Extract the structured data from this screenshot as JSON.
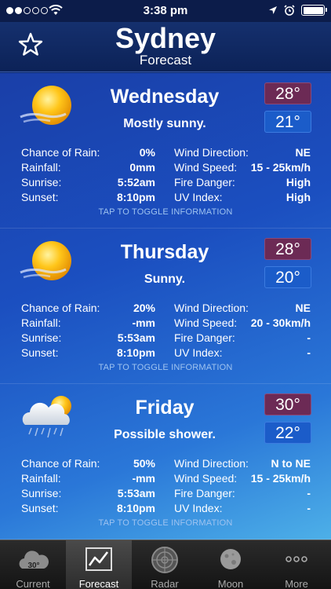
{
  "status": {
    "time": "3:38 pm",
    "signal_bars": 2,
    "battery_level": 1.0
  },
  "header": {
    "city": "Sydney",
    "subtitle": "Forecast"
  },
  "labels": {
    "chance_of_rain": "Chance of Rain:",
    "rainfall": "Rainfall:",
    "sunrise": "Sunrise:",
    "sunset": "Sunset:",
    "wind_direction": "Wind Direction:",
    "wind_speed": "Wind Speed:",
    "fire_danger": "Fire Danger:",
    "uv_index": "UV Index:",
    "toggle": "TAP TO TOGGLE INFORMATION"
  },
  "days": [
    {
      "name": "Wednesday",
      "summary": "Mostly sunny.",
      "icon": "sun-icon",
      "high": "28°",
      "low": "21°",
      "chance_of_rain": "0%",
      "rainfall": "0mm",
      "sunrise": "5:52am",
      "sunset": "8:10pm",
      "wind_direction": "NE",
      "wind_speed": "15 - 25km/h",
      "fire_danger": "High",
      "uv_index": "High"
    },
    {
      "name": "Thursday",
      "summary": "Sunny.",
      "icon": "sun-icon",
      "high": "28°",
      "low": "20°",
      "chance_of_rain": "20%",
      "rainfall": "-mm",
      "sunrise": "5:53am",
      "sunset": "8:10pm",
      "wind_direction": "NE",
      "wind_speed": "20 - 30km/h",
      "fire_danger": "-",
      "uv_index": "-"
    },
    {
      "name": "Friday",
      "summary": "Possible shower.",
      "icon": "shower-icon",
      "high": "30°",
      "low": "22°",
      "chance_of_rain": "50%",
      "rainfall": "-mm",
      "sunrise": "5:53am",
      "sunset": "8:10pm",
      "wind_direction": "N to NE",
      "wind_speed": "15 - 25km/h",
      "fire_danger": "-",
      "uv_index": "-"
    }
  ],
  "tabs": [
    {
      "label": "Current",
      "icon": "current-weather-icon",
      "icon_text": "30°",
      "active": false
    },
    {
      "label": "Forecast",
      "icon": "forecast-chart-icon",
      "active": true
    },
    {
      "label": "Radar",
      "icon": "radar-icon",
      "active": false
    },
    {
      "label": "Moon",
      "icon": "moon-icon",
      "active": false
    },
    {
      "label": "More",
      "icon": "more-icon",
      "active": false
    }
  ],
  "colors": {
    "high_temp_bg": "#6c2a55",
    "low_temp_bg": "#1b5cc9",
    "accent_sun": "#f5b800"
  }
}
